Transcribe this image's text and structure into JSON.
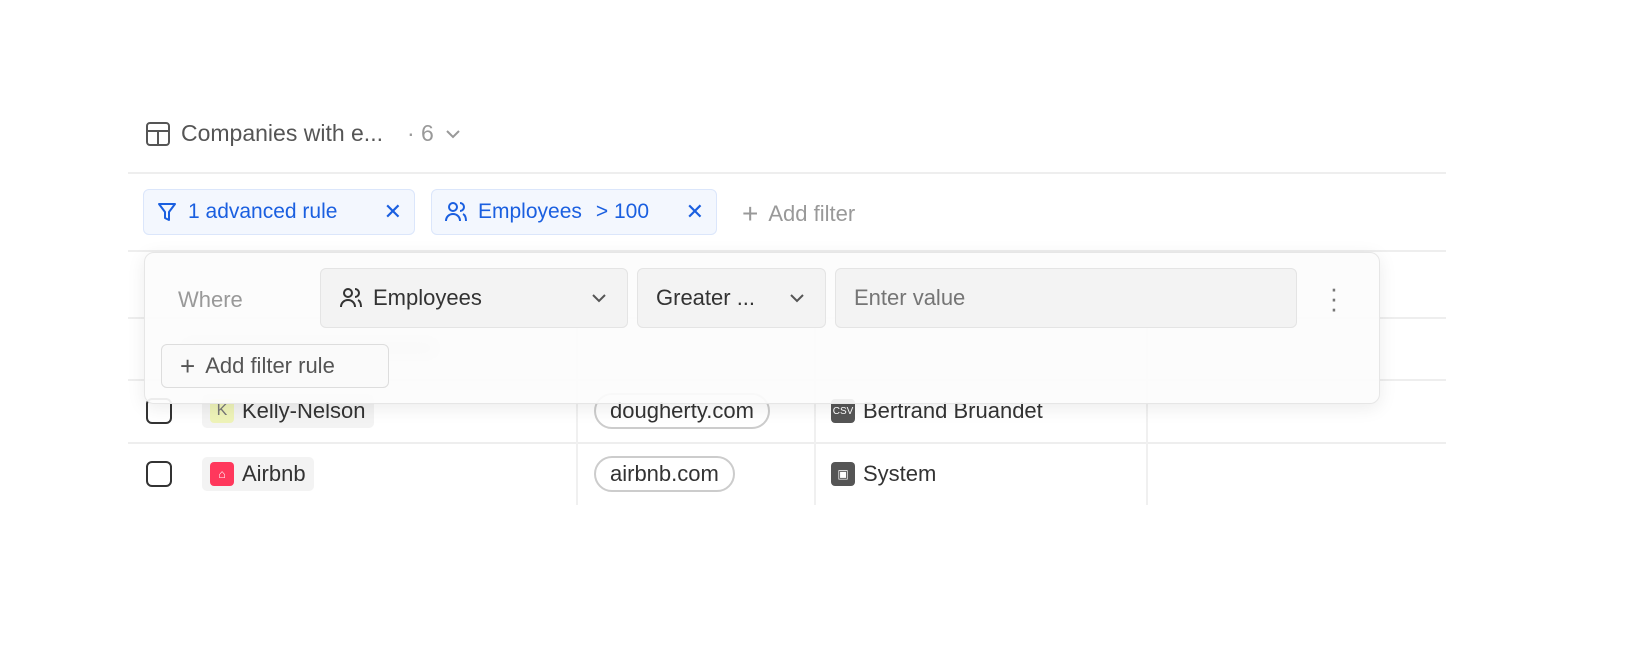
{
  "view": {
    "title": "Companies with e...",
    "count": "· 6"
  },
  "filters": {
    "advanced": "1 advanced rule",
    "field": "Employees",
    "condition": "> 100",
    "add": "Add filter"
  },
  "popover": {
    "where": "Where",
    "field": "Employees",
    "operator": "Greater ...",
    "value_placeholder": "Enter value",
    "add_rule": "Add filter rule"
  },
  "rows": [
    {
      "name": "Kelly-Nelson",
      "initial": "K",
      "domain": "dougherty.com",
      "creator_badge": "CSV",
      "creator": "Bertrand Bruandet"
    },
    {
      "name": "Airbnb",
      "domain": "airbnb.com",
      "creator": "System"
    }
  ],
  "colors": {
    "accent": "#1a5fe0",
    "airbnb": "#ff385c"
  }
}
